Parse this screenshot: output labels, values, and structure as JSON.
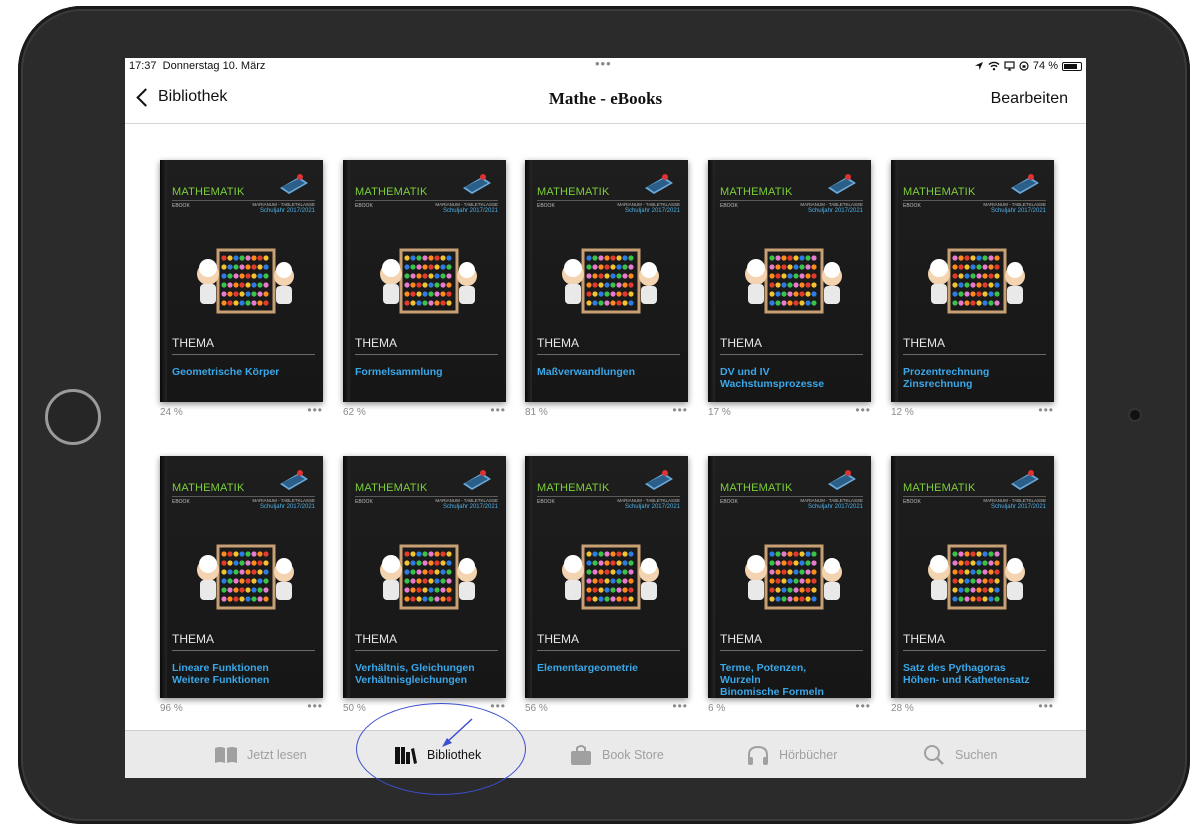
{
  "status_bar": {
    "time": "17:37",
    "date": "Donnerstag 10. März",
    "dots": "•••",
    "battery": "74 %"
  },
  "nav": {
    "back_label": "Bibliothek",
    "title": "Mathe - eBooks",
    "edit_label": "Bearbeiten"
  },
  "cover_text": {
    "subject": "MATHEMATIK",
    "ebook": "EBOOK",
    "class": "MARIANUM - TABLETKLASSE",
    "year": "Schuljahr 2017/2021",
    "thema": "THEMA"
  },
  "books": [
    {
      "title": "Geometrische Körper",
      "progress": "24 %",
      "more": "•••"
    },
    {
      "title": "Formelsammlung",
      "progress": "62 %",
      "more": "•••"
    },
    {
      "title": "Maßverwandlungen",
      "progress": "81 %",
      "more": "•••"
    },
    {
      "title": "DV und IV\nWachstumsprozesse",
      "progress": "17 %",
      "more": "•••"
    },
    {
      "title": "Prozentrechnung\nZinsrechnung",
      "progress": "12 %",
      "more": "•••"
    },
    {
      "title": "Lineare Funktionen\nWeitere Funktionen",
      "progress": "96 %",
      "more": "•••"
    },
    {
      "title": "Verhältnis, Gleichungen\nVerhältnisgleichungen",
      "progress": "50 %",
      "more": "•••"
    },
    {
      "title": "Elementargeometrie",
      "progress": "56 %",
      "more": "•••"
    },
    {
      "title": "Terme, Potenzen,\nWurzeln\nBinomische Formeln",
      "progress": "6 %",
      "more": "•••"
    },
    {
      "title": "Satz des Pythagoras\nHöhen- und Kathetensatz",
      "progress": "28 %",
      "more": "•••"
    }
  ],
  "tabs": [
    {
      "label": "Jetzt lesen",
      "icon": "book-open-icon",
      "active": false
    },
    {
      "label": "Bibliothek",
      "icon": "library-icon",
      "active": true
    },
    {
      "label": "Book Store",
      "icon": "shopping-bag-icon",
      "active": false
    },
    {
      "label": "Hörbücher",
      "icon": "headphones-icon",
      "active": false
    },
    {
      "label": "Suchen",
      "icon": "search-icon",
      "active": false
    }
  ],
  "colors": {
    "subject_green": "#7ccf3a",
    "title_blue": "#3aa7e8",
    "annotation_blue": "#3a4fcf",
    "tab_inactive": "#a0a0a0"
  }
}
